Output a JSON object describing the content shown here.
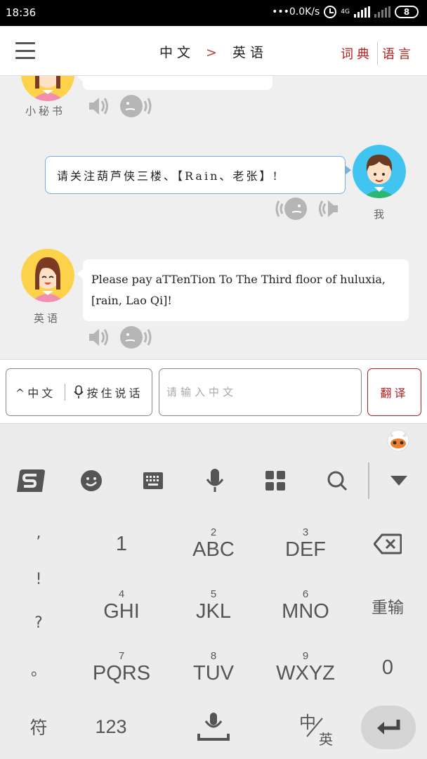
{
  "status_bar": {
    "time": "18:36",
    "speed": "•••0.0K/s",
    "battery": "8",
    "net": "4G"
  },
  "header": {
    "source_lang": "中文",
    "arrow": ">",
    "target_lang": "英语",
    "link_dict": "词典",
    "link_lang": "语言"
  },
  "chat": {
    "top_label": "小秘书",
    "user_message": "请关注葫芦侠三楼、【Rain、老张】!",
    "user_label": "我",
    "reply_message": "Please pay aTTenTion To The Third floor of huluxia, [rain, Lao Qi]!",
    "reply_label": "英语"
  },
  "input_bar": {
    "lang_toggle": "^中文",
    "hold_to_talk": "按住说话",
    "placeholder": "请输入中文",
    "translate_button": "翻译"
  },
  "keyboard": {
    "punct": [
      ",",
      "!",
      "?",
      "。"
    ],
    "keys": [
      {
        "num": "",
        "label": "1"
      },
      {
        "num": "2",
        "label": "ABC"
      },
      {
        "num": "3",
        "label": "DEF"
      },
      {
        "num": "4",
        "label": "GHI"
      },
      {
        "num": "5",
        "label": "JKL"
      },
      {
        "num": "6",
        "label": "MNO"
      },
      {
        "num": "7",
        "label": "PQRS"
      },
      {
        "num": "8",
        "label": "TUV"
      },
      {
        "num": "9",
        "label": "WXYZ"
      }
    ],
    "reenter": "重输",
    "zero": "0",
    "symbols": "符",
    "numbers": "123",
    "lang_cn": "中",
    "lang_en": "英"
  },
  "colors": {
    "accent_red": "#b21e1e",
    "bubble_border": "#79aee0",
    "keyboard_bg": "#ececec"
  },
  "icons": [
    "menu-icon",
    "speaker-icon",
    "voice-play-icon",
    "mic-icon",
    "backspace-icon",
    "enter-icon",
    "space-icon",
    "sogou-logo-icon",
    "emoji-icon",
    "keyboard-icon",
    "grid-icon",
    "search-icon",
    "collapse-icon"
  ]
}
